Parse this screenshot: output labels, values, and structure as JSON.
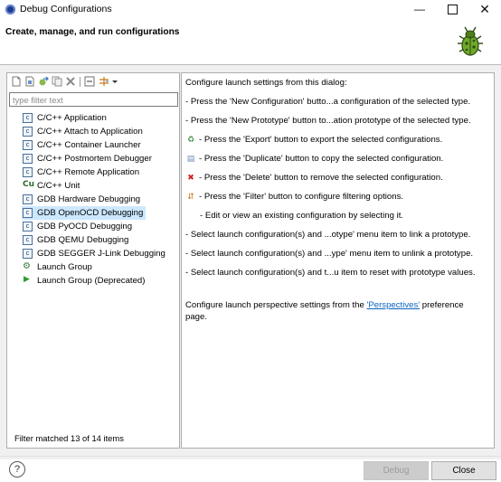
{
  "window": {
    "title": "Debug Configurations",
    "minimize": "—",
    "close": "✕"
  },
  "header": {
    "title": "Create, manage, and run configurations",
    "icon": "bug-icon"
  },
  "toolbar": {
    "icons": [
      "new-configuration-icon",
      "new-prototype-icon",
      "export-icon",
      "duplicate-icon",
      "delete-icon",
      "collapse-all-icon",
      "filter-icon",
      "dropdown-icon"
    ]
  },
  "filter": {
    "placeholder": "type filter text",
    "value": ""
  },
  "tree": {
    "items": [
      {
        "label": "C/C++ Application",
        "icon": "c-icon",
        "selected": false
      },
      {
        "label": "C/C++ Attach to Application",
        "icon": "c-icon",
        "selected": false
      },
      {
        "label": "C/C++ Container Launcher",
        "icon": "c-icon",
        "selected": false
      },
      {
        "label": "C/C++ Postmortem Debugger",
        "icon": "c-icon",
        "selected": false
      },
      {
        "label": "C/C++ Remote Application",
        "icon": "c-icon",
        "selected": false
      },
      {
        "label": "C/C++ Unit",
        "icon": "cu-icon",
        "selected": false
      },
      {
        "label": "GDB Hardware Debugging",
        "icon": "c-icon",
        "selected": false
      },
      {
        "label": "GDB OpenOCD Debugging",
        "icon": "c-icon",
        "selected": true
      },
      {
        "label": "GDB PyOCD Debugging",
        "icon": "c-icon",
        "selected": false
      },
      {
        "label": "GDB QEMU Debugging",
        "icon": "c-icon",
        "selected": false
      },
      {
        "label": "GDB SEGGER J-Link Debugging",
        "icon": "c-icon",
        "selected": false
      },
      {
        "label": "Launch Group",
        "icon": "launch-group-icon",
        "selected": false
      },
      {
        "label": "Launch Group (Deprecated)",
        "icon": "play-icon",
        "selected": false
      }
    ]
  },
  "status": "Filter matched 13 of 14 items",
  "info": {
    "intro": "Configure launch settings from this dialog:",
    "lines": [
      "- Press the 'New Configuration' butto...a configuration of the selected type.",
      "- Press the 'New Prototype' button to...ation prototype of the selected type.",
      "- Press the 'Export' button to export the selected configurations.",
      "- Press the 'Duplicate' button to copy the selected configuration.",
      "- Press the 'Delete' button to remove the selected configuration.",
      "- Press the 'Filter' button to configure filtering options.",
      "- Edit or view an existing configuration by selecting it.",
      "- Select launch configuration(s) and ...otype' menu item to link a prototype.",
      "- Select launch configuration(s) and ...ype' menu item to unlink a prototype.",
      "- Select launch configuration(s) and t...u item to reset with prototype values."
    ],
    "perspective_prefix": "Configure launch perspective settings from the ",
    "perspective_link": "'Perspectives'",
    "perspective_suffix": " preference",
    "perspective_line2": "page."
  },
  "footer": {
    "help": "?",
    "debug_label": "Debug",
    "close_label": "Close"
  },
  "colors": {
    "selection": "#cce8ff",
    "link": "#0b64c0",
    "delete": "#d02020"
  }
}
